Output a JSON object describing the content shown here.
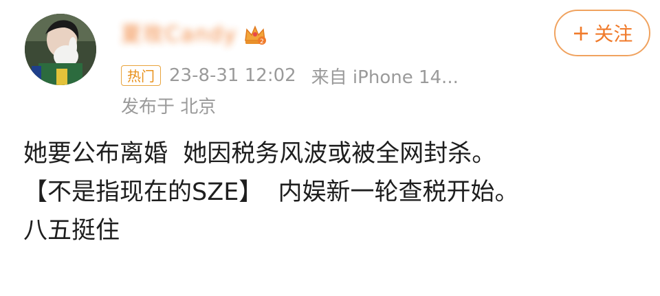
{
  "user": {
    "name": "夏玫Candy",
    "crown_level": "2"
  },
  "meta": {
    "hot_label": "热门",
    "timestamp": "23-8-31 12:02",
    "source": "来自 iPhone 14...",
    "location": "发布于 北京"
  },
  "follow": {
    "plus": "+",
    "label": "关注"
  },
  "post": {
    "lines": [
      "她要公布离婚  她因税务风波或被全网封杀。",
      "【不是指现在的SZE】  内娱新一轮查税开始。",
      "八五挺住"
    ]
  },
  "colors": {
    "accent": "#f07a2a",
    "meta_gray": "#9a9a9a",
    "hot_border": "#e8a23a"
  },
  "icons": {
    "avatar": "user-avatar",
    "crown": "crown-icon",
    "plus": "plus-icon"
  }
}
